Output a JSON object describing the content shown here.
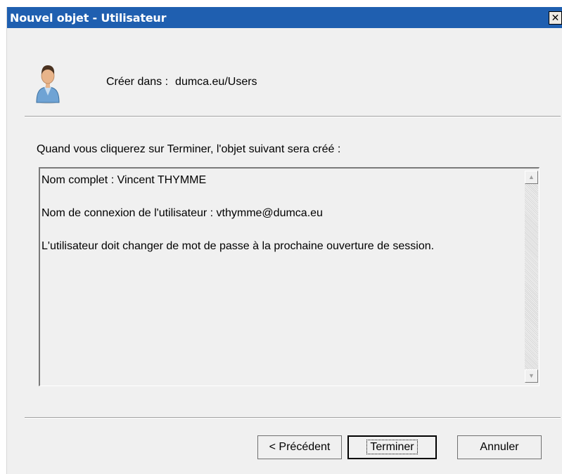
{
  "window": {
    "title": "Nouvel objet - Utilisateur",
    "close_glyph": "✕"
  },
  "header": {
    "create_label": "Créer dans :",
    "create_path": "dumca.eu/Users",
    "icon": "user-icon"
  },
  "instruction": "Quand vous cliquerez sur Terminer, l'objet suivant sera créé :",
  "summary": {
    "lines": [
      "Nom complet : Vincent THYMME",
      "Nom de connexion de l'utilisateur : vthymme@dumca.eu",
      "L'utilisateur doit changer de mot de passe à la prochaine ouverture de session."
    ]
  },
  "buttons": {
    "previous": "< Précédent",
    "finish": "Terminer",
    "cancel": "Annuler"
  },
  "colors": {
    "titlebar": "#1f5fb0",
    "dialog_bg": "#f0f0f0"
  }
}
